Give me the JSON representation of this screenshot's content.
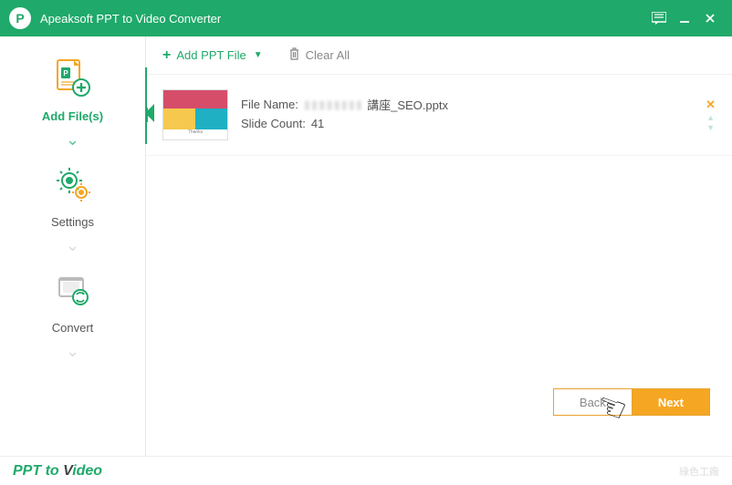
{
  "titlebar": {
    "title": "Apeaksoft PPT to Video Converter"
  },
  "sidebar": {
    "steps": [
      {
        "label": "Add File(s)"
      },
      {
        "label": "Settings"
      },
      {
        "label": "Convert"
      }
    ]
  },
  "toolbar": {
    "add_label": "Add PPT File",
    "clear_label": "Clear All"
  },
  "files": [
    {
      "name_label": "File Name:",
      "name_suffix": "講座_SEO.pptx",
      "count_label": "Slide Count:",
      "count_value": "41"
    }
  ],
  "footer": {
    "brand_a": "PPT to ",
    "brand_b": "V",
    "brand_c": "ideo",
    "watermark": "綠色工廠"
  },
  "buttons": {
    "back": "Back",
    "next": "Next"
  }
}
